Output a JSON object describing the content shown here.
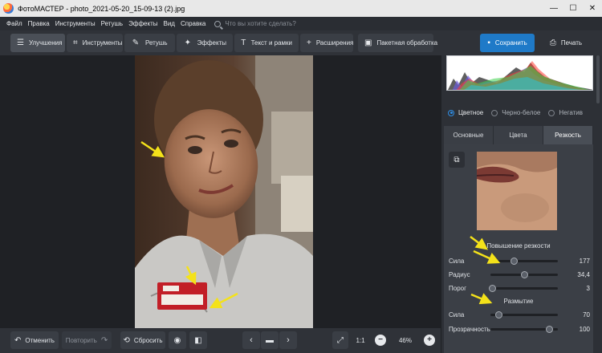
{
  "titlebar": {
    "app_name": "ФотоМАСТЕР",
    "separator": " - ",
    "filename": "photo_2021-05-20_15-09-13 (2).jpg",
    "minimize": "—",
    "maximize": "☐",
    "close": "✕"
  },
  "menu": {
    "items": [
      "Файл",
      "Правка",
      "Инструменты",
      "Ретушь",
      "Эффекты",
      "Вид",
      "Справка"
    ],
    "search_placeholder": "Что вы хотите сделать?"
  },
  "toolbar": {
    "tabs": [
      {
        "label": "Улучшения",
        "icon": "sliders-icon",
        "active": true
      },
      {
        "label": "Инструменты",
        "icon": "crop-icon"
      },
      {
        "label": "Ретушь",
        "icon": "brush-icon"
      },
      {
        "label": "Эффекты",
        "icon": "magic-wand-icon"
      },
      {
        "label": "Текст и рамки",
        "icon": "text-icon"
      },
      {
        "label": "Расширения",
        "icon": "plus-icon"
      },
      {
        "label": "Пакетная обработка",
        "icon": "batch-icon"
      }
    ],
    "save_label": "Сохранить",
    "print_label": "Печать"
  },
  "bottombar": {
    "undo_label": "Отменить",
    "redo_label": "Повторить",
    "reset_label": "Сбросить",
    "zoom_ratio": "1:1",
    "zoom_percent": "46%"
  },
  "panel": {
    "modes": [
      "Цветное",
      "Черно-белое",
      "Негатив"
    ],
    "active_mode": "Цветное",
    "tabs": [
      "Основные",
      "Цвета",
      "Резкость"
    ],
    "active_tab": "Резкость",
    "sharpen_title": "Повышение резкости",
    "sharpen": [
      {
        "label": "Сила",
        "value": "177",
        "level": 0.35
      },
      {
        "label": "Радиус",
        "value": "34,4",
        "level": 0.5
      },
      {
        "label": "Порог",
        "value": "3",
        "level": 0.03
      }
    ],
    "blur_title": "Размытие",
    "blur": [
      {
        "label": "Сила",
        "value": "70",
        "level": 0.13
      },
      {
        "label": "Прозрачность",
        "value": "100",
        "level": 0.88
      }
    ]
  },
  "colors": {
    "accent": "#1f7ac8",
    "arrow": "#f4e21a",
    "panel_bg": "#2d3036",
    "canvas_bg": "#1f2125"
  }
}
